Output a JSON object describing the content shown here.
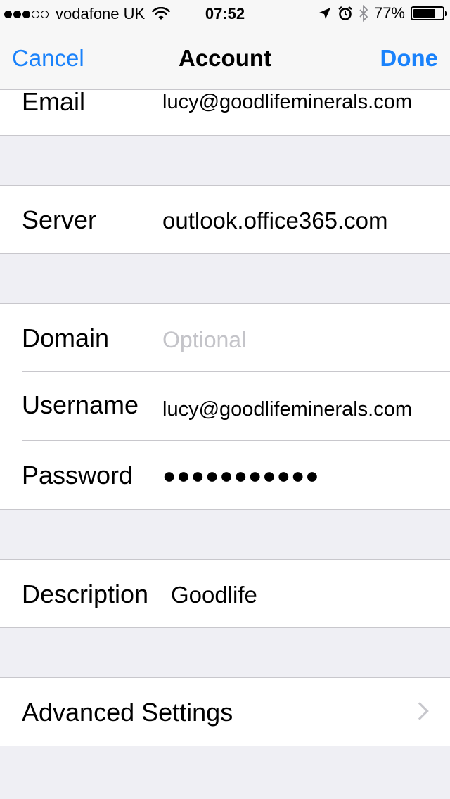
{
  "status_bar": {
    "carrier": "vodafone UK",
    "time": "07:52",
    "battery_percent": "77%",
    "battery_level": 0.77,
    "signal_bars": 3,
    "signal_total": 5,
    "icons": [
      "wifi-icon",
      "location-arrow-icon",
      "alarm-icon",
      "bluetooth-icon",
      "battery-icon"
    ]
  },
  "nav": {
    "cancel_label": "Cancel",
    "title": "Account",
    "done_label": "Done"
  },
  "fields": {
    "email": {
      "label": "Email",
      "value": "lucy@goodlifeminerals.com"
    },
    "server": {
      "label": "Server",
      "value": "outlook.office365.com"
    },
    "domain": {
      "label": "Domain",
      "placeholder": "Optional",
      "value": ""
    },
    "username": {
      "label": "Username",
      "value": "lucy@goodlifeminerals.com"
    },
    "password": {
      "label": "Password",
      "value": "●●●●●●●●●●●"
    },
    "description": {
      "label": "Description",
      "value": "Goodlife"
    },
    "advanced": {
      "label": "Advanced Settings"
    }
  },
  "colors": {
    "accent": "#1a82fb",
    "background": "#efeff4",
    "separator": "#c8c7cc",
    "placeholder": "#c4c4c9"
  }
}
